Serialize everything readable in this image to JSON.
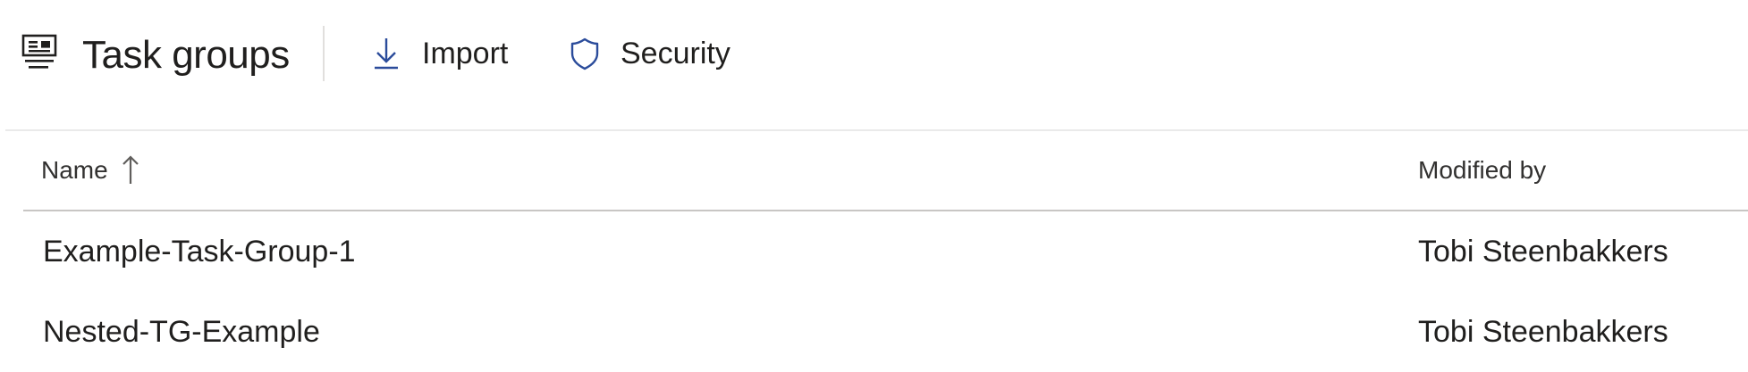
{
  "header": {
    "title": "Task groups",
    "title_icon": "task-groups-icon",
    "actions": [
      {
        "label": "Import",
        "icon": "download-icon"
      },
      {
        "label": "Security",
        "icon": "shield-icon"
      }
    ]
  },
  "table": {
    "columns": [
      {
        "label": "Name",
        "sort": "ascending",
        "sort_icon": "arrow-up-icon"
      },
      {
        "label": "Modified by"
      }
    ],
    "rows": [
      {
        "name": "Example-Task-Group-1",
        "modified_by": "Tobi Steenbakkers"
      },
      {
        "name": "Nested-TG-Example",
        "modified_by": "Tobi Steenbakkers"
      }
    ]
  },
  "colors": {
    "icon_accent": "#2b4c9b",
    "text": "#201f1e",
    "divider": "#c8c6c4"
  }
}
